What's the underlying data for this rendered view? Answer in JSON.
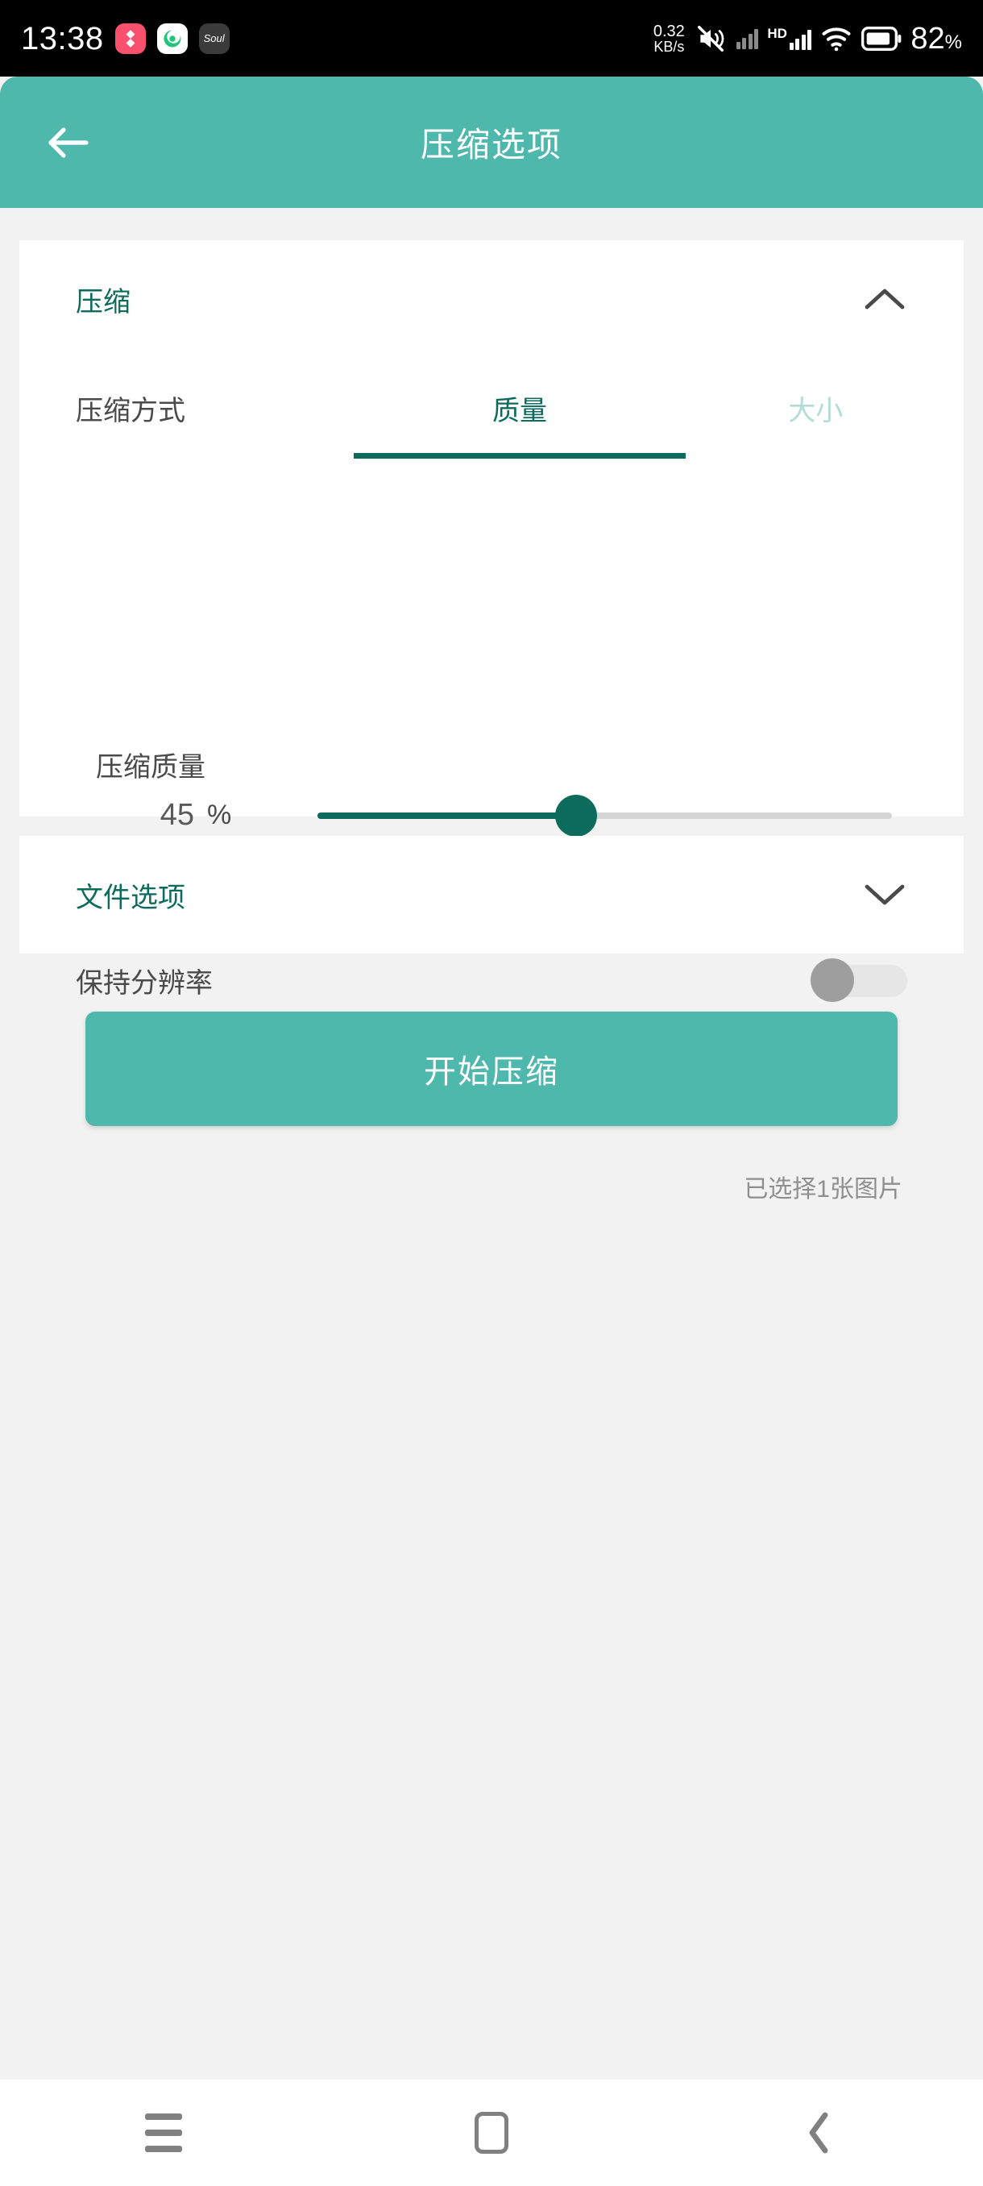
{
  "status_bar": {
    "clock": "13:38",
    "network_speed_value": "0.32",
    "network_speed_unit": "KB/s",
    "hd_label": "HD",
    "battery_percent": "82",
    "battery_percent_symbol": "%",
    "app_icons": [
      {
        "name": "pink-heart-app-icon",
        "glyph": "❖"
      },
      {
        "name": "green-swirl-app-icon",
        "glyph": "◉"
      },
      {
        "name": "soul-app-icon",
        "glyph": "Soul"
      }
    ],
    "icons": [
      "mute-icon",
      "signal-no-service-icon",
      "signal-bars-icon",
      "wifi-icon",
      "battery-icon"
    ]
  },
  "app_bar": {
    "title": "压缩选项",
    "back_icon": "arrow-left-icon",
    "background": "#4fb8ac"
  },
  "compress_card": {
    "header_title": "压缩",
    "collapse_icon": "chevron-up-icon",
    "method_label": "压缩方式",
    "tabs": [
      {
        "label": "质量",
        "active": true
      },
      {
        "label": "大小",
        "active": false
      }
    ],
    "quality_label": "压缩质量",
    "quality_value": "45",
    "percent_symbol": "%",
    "slider": {
      "min": 0,
      "max": 100,
      "value": 45,
      "active_color": "#0d6b5d",
      "track_color": "#d6d6d6"
    },
    "keep_resolution_label": "保持分辨率",
    "keep_resolution_on": false
  },
  "file_options_card": {
    "header_title": "文件选项",
    "expand_icon": "chevron-down-icon"
  },
  "action": {
    "start_button_label": "开始压缩",
    "selection_note": "已选择1张图片",
    "button_color": "#4fb8ac"
  },
  "nav_bar": {
    "recents_icon": "recents-menu-icon",
    "home_icon": "home-square-icon",
    "back_icon": "back-chevron-icon"
  }
}
